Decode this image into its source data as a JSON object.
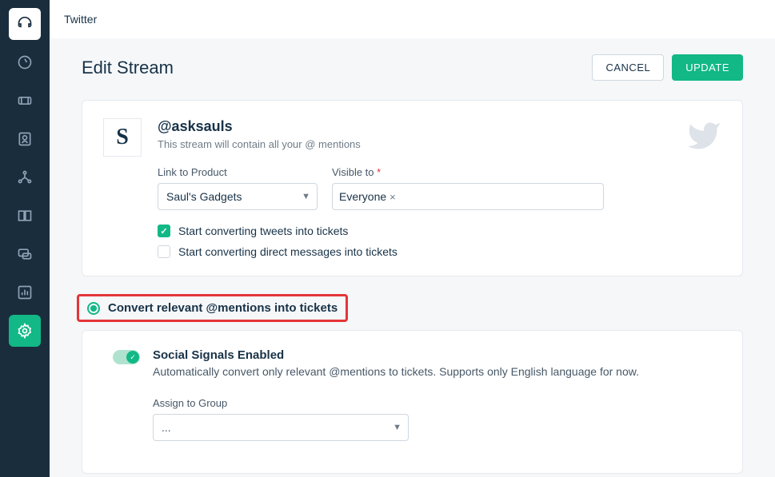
{
  "topbar": {
    "title": "Twitter"
  },
  "page": {
    "title": "Edit Stream",
    "cancel": "CANCEL",
    "update": "UPDATE"
  },
  "account": {
    "avatar_letter": "S",
    "handle": "@asksauls",
    "desc": "This stream will contain all your @ mentions"
  },
  "form": {
    "link_label": "Link to Product",
    "link_value": "Saul's Gadgets",
    "visible_label": "Visible to",
    "visible_tag": "Everyone",
    "chk_tweets": "Start converting tweets into tickets",
    "chk_dm": "Start converting direct messages into tickets"
  },
  "relevant": {
    "label": "Convert relevant @mentions into tickets"
  },
  "signals": {
    "title": "Social Signals Enabled",
    "desc": "Automatically convert only relevant @mentions to tickets. Supports only English language for now.",
    "group_label": "Assign to Group",
    "group_value": "..."
  }
}
